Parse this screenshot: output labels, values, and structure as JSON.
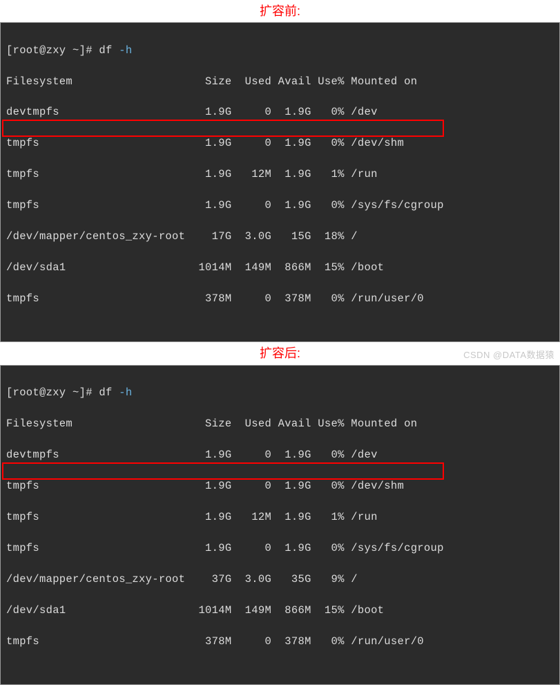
{
  "captions": {
    "before": "扩容前:",
    "after": "扩容后:"
  },
  "before": {
    "prompt": "[root@zxy ~]# ",
    "cmd": "df ",
    "flag": "-h",
    "header": "Filesystem                    Size  Used Avail Use% Mounted on",
    "rows": [
      "devtmpfs                      1.9G     0  1.9G   0% /dev",
      "tmpfs                         1.9G     0  1.9G   0% /dev/shm",
      "tmpfs                         1.9G   12M  1.9G   1% /run",
      "tmpfs                         1.9G     0  1.9G   0% /sys/fs/cgroup",
      "/dev/mapper/centos_zxy-root    17G  3.0G   15G  18% /",
      "/dev/sda1                    1014M  149M  866M  15% /boot",
      "tmpfs                         378M     0  378M   0% /run/user/0"
    ]
  },
  "after": {
    "prompt": "[root@zxy ~]# ",
    "cmd": "df ",
    "flag": "-h",
    "header": "Filesystem                    Size  Used Avail Use% Mounted on",
    "rows": [
      "devtmpfs                      1.9G     0  1.9G   0% /dev",
      "tmpfs                         1.9G     0  1.9G   0% /dev/shm",
      "tmpfs                         1.9G   12M  1.9G   1% /run",
      "tmpfs                         1.9G     0  1.9G   0% /sys/fs/cgroup",
      "/dev/mapper/centos_zxy-root    37G  3.0G   35G   9% /",
      "/dev/sda1                    1014M  149M  866M  15% /boot",
      "tmpfs                         378M     0  378M   0% /run/user/0"
    ]
  },
  "watermark": "CSDN @DATA数据猿"
}
